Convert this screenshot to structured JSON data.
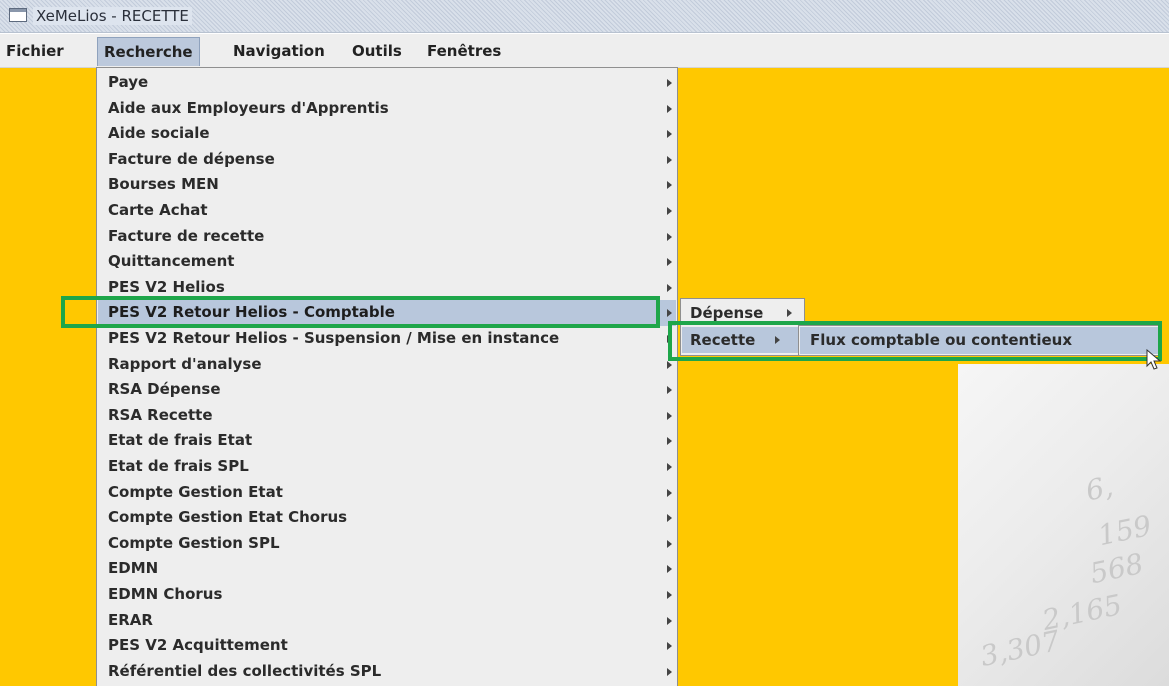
{
  "window": {
    "title": "XeMeLios - RECETTE"
  },
  "menubar": {
    "items": [
      "Fichier",
      "Recherche",
      "Navigation",
      "Outils",
      "Fenêtres"
    ],
    "active": "Recherche"
  },
  "menu": {
    "items": [
      "Paye",
      "Aide aux Employeurs d'Apprentis",
      "Aide sociale",
      "Facture de dépense",
      "Bourses MEN",
      "Carte Achat",
      "Facture de recette",
      "Quittancement",
      "PES V2 Helios",
      "PES V2 Retour Helios - Comptable",
      "PES V2 Retour Helios - Suspension / Mise en instance",
      "Rapport d'analyse",
      "RSA Dépense",
      "RSA Recette",
      "Etat de frais Etat",
      "Etat de frais SPL",
      "Compte Gestion Etat",
      "Compte Gestion Etat Chorus",
      "Compte Gestion SPL",
      "EDMN",
      "EDMN Chorus",
      "ERAR",
      "PES V2 Acquittement",
      "Référentiel des collectivités SPL"
    ],
    "selected": "PES V2 Retour Helios - Comptable"
  },
  "submenu": {
    "items": [
      "Dépense",
      "Recette"
    ],
    "selected": "Recette"
  },
  "submenu2": {
    "items": [
      "Flux comptable ou contentieux"
    ]
  },
  "background_numbers": [
    "6,",
    "159",
    "568",
    "2,165",
    "3,307"
  ],
  "colors": {
    "desktop": "#ffc800",
    "menu_bg": "#eeeeee",
    "selection": "#b8c7dc",
    "highlight": "#1ea64a"
  }
}
